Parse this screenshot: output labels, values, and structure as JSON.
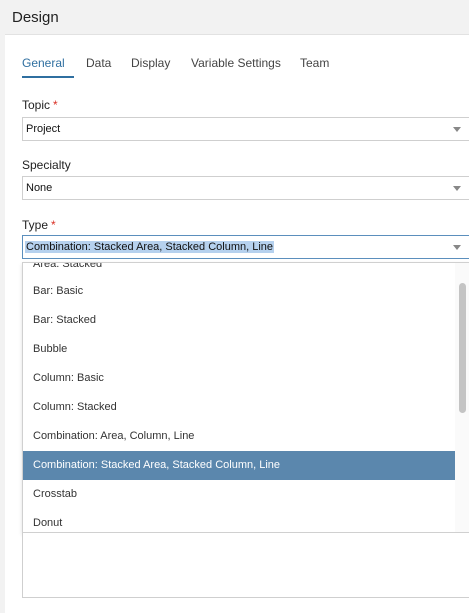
{
  "panel": {
    "title": "Design"
  },
  "tabs": [
    {
      "label": "General"
    },
    {
      "label": "Data"
    },
    {
      "label": "Display"
    },
    {
      "label": "Variable Settings"
    },
    {
      "label": "Team"
    }
  ],
  "fields": {
    "topic": {
      "label": "Topic",
      "required_mark": "*",
      "value": "Project"
    },
    "specialty": {
      "label": "Specialty",
      "value": "None"
    },
    "type": {
      "label": "Type",
      "required_mark": "*",
      "value": "Combination: Stacked Area, Stacked Column, Line"
    }
  },
  "type_options": [
    "Area: Stacked",
    "Bar: Basic",
    "Bar: Stacked",
    "Bubble",
    "Column: Basic",
    "Column: Stacked",
    "Combination: Area, Column, Line",
    "Combination: Stacked Area, Stacked Column, Line",
    "Crosstab",
    "Donut"
  ],
  "colors": {
    "accent": "#2f6fa0",
    "selected_option_bg": "#5b87ad",
    "required": "#d93025"
  },
  "icons": [
    "chevron-down-icon"
  ]
}
